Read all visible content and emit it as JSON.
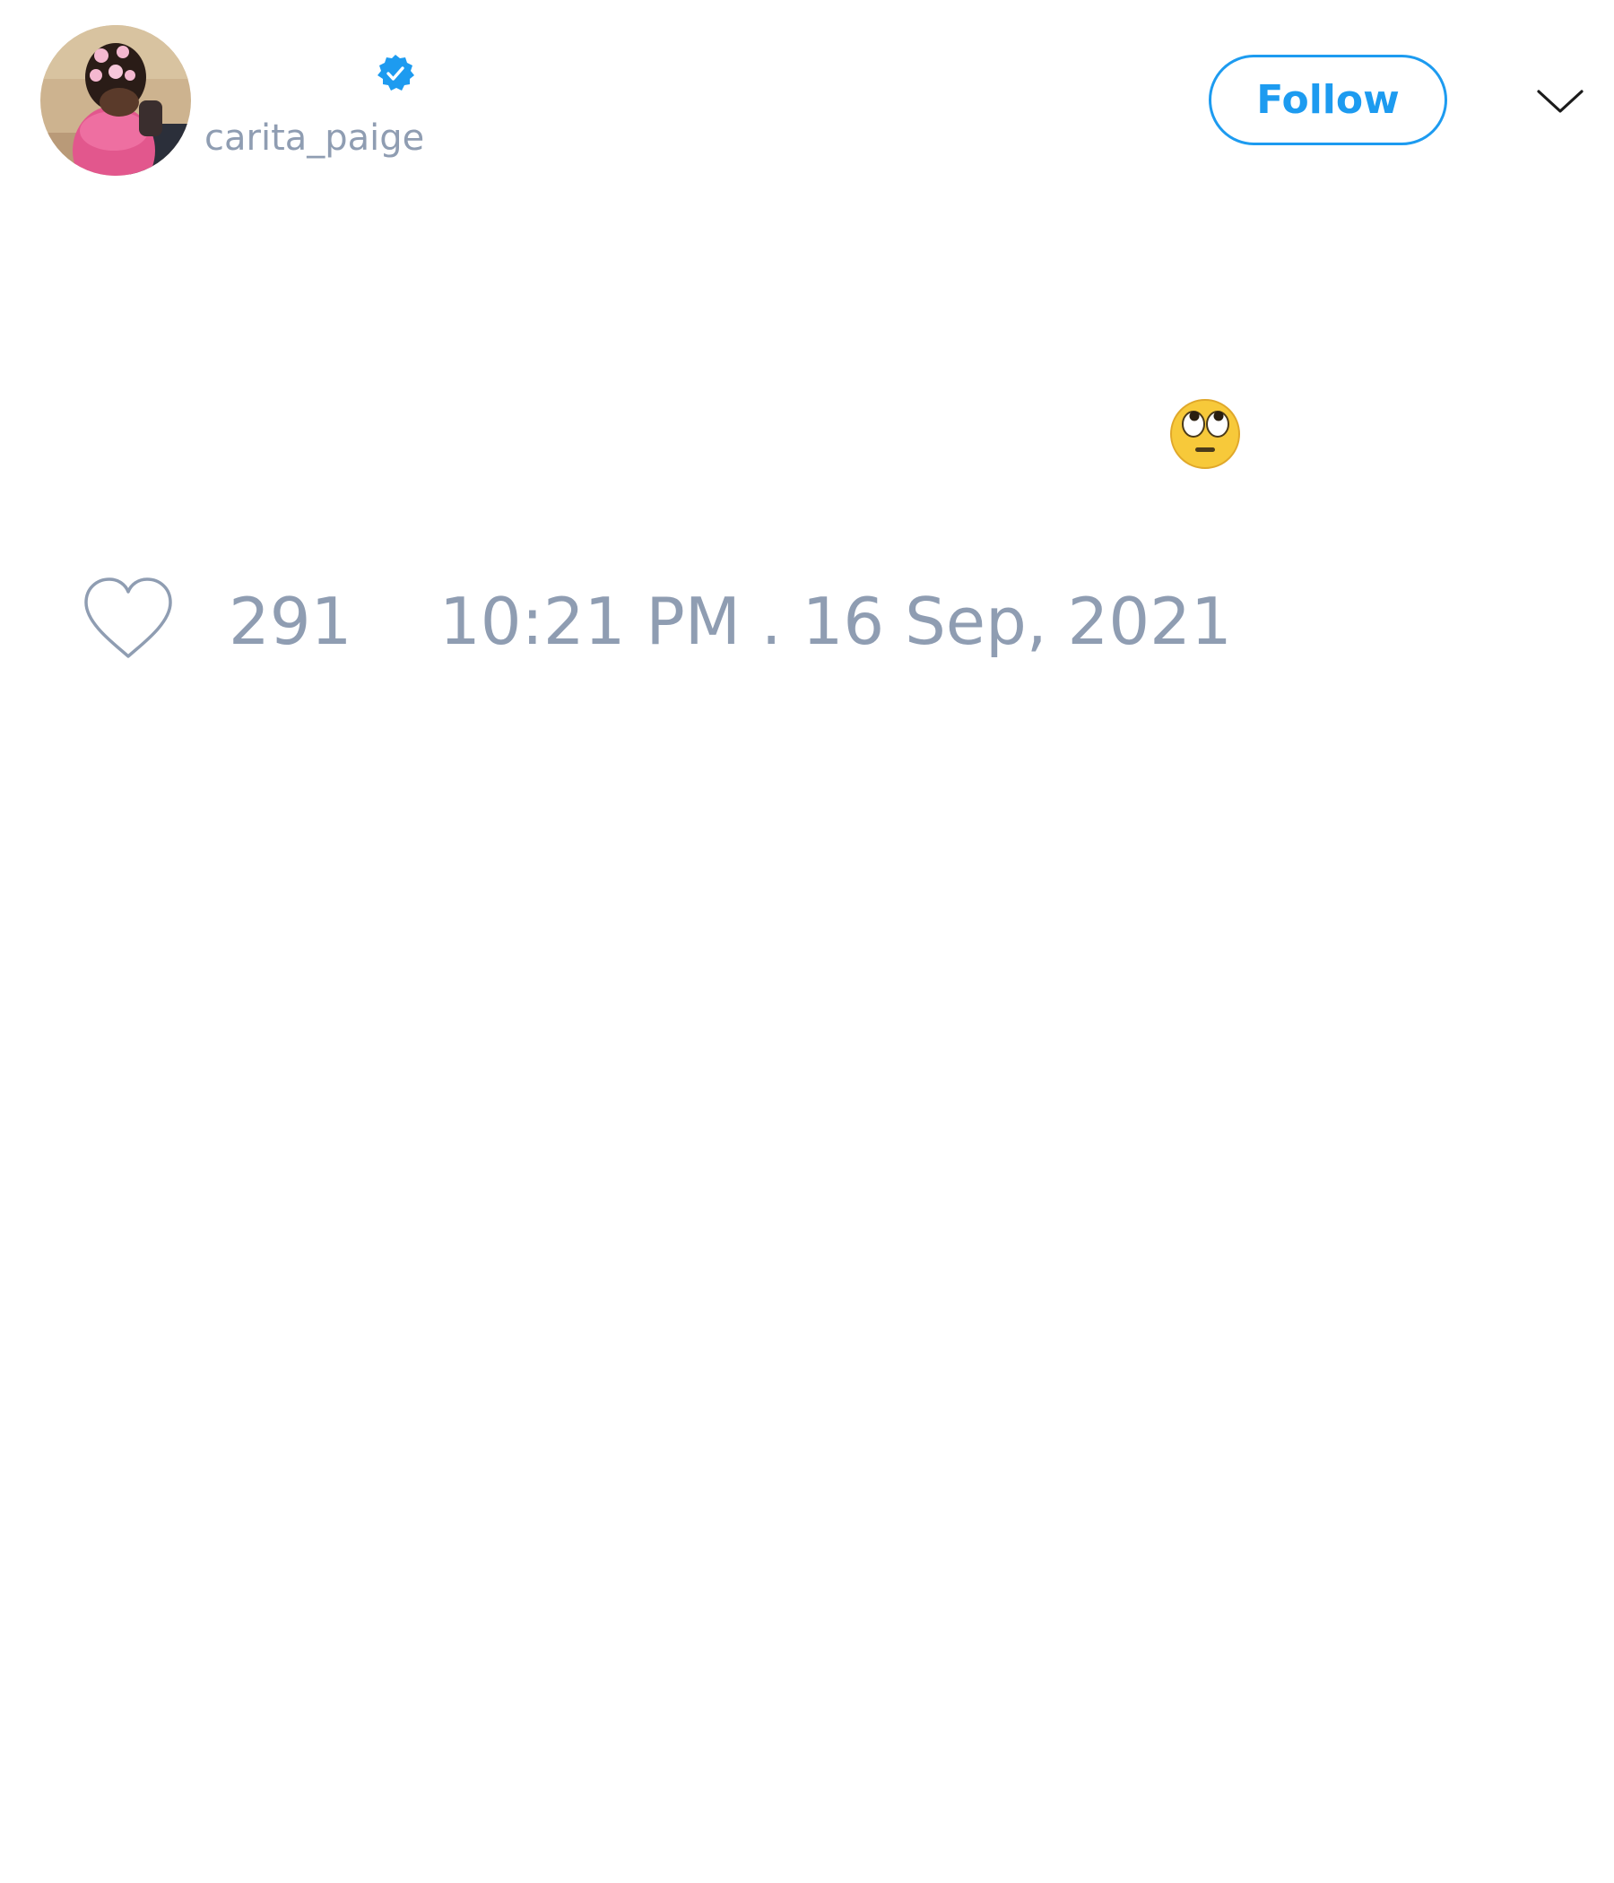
{
  "tweet": {
    "author": {
      "display_name": "",
      "handle": "carita_paige",
      "verified": true,
      "avatar_icon": "avatar-photo"
    },
    "follow_label": "Follow",
    "menu_icon": "chevron-down-icon",
    "text": "🙄",
    "likes": "291",
    "timestamp": "10:21 PM . 16 Sep, 2021"
  },
  "colors": {
    "accent": "#1d9bf0",
    "muted": "#8f9db2",
    "background": "#ffffff"
  }
}
